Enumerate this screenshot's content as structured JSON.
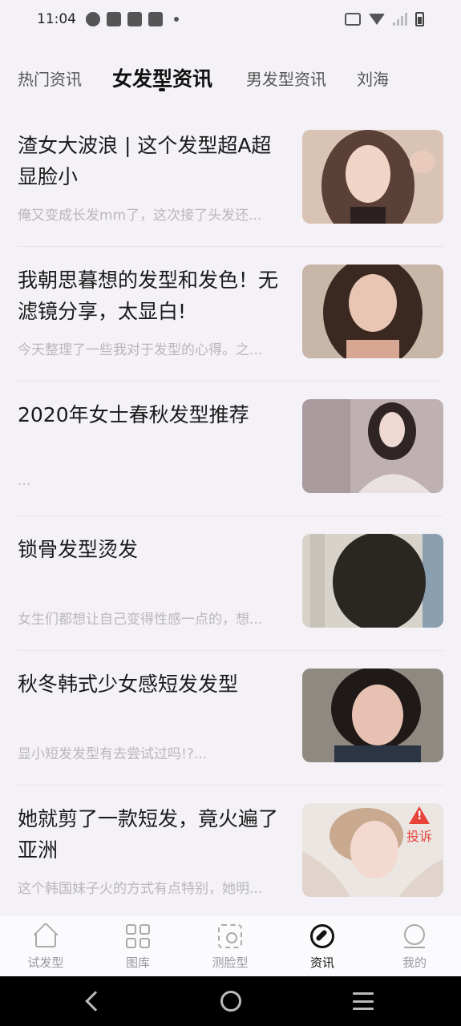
{
  "status_bar": {
    "time": "11:04",
    "icons": [
      "camera-icon",
      "mail-icon",
      "mail-icon",
      "mail-icon",
      "dot-icon"
    ],
    "right_icons": [
      "vibrate-icon",
      "wifi-icon",
      "signal-icon",
      "battery-icon"
    ]
  },
  "tabs": [
    {
      "label": "热门资讯",
      "active": false
    },
    {
      "label": "女发型资讯",
      "active": true
    },
    {
      "label": "男发型资讯",
      "active": false
    },
    {
      "label": "刘海",
      "active": false
    }
  ],
  "articles": [
    {
      "title": "渣女大波浪 | 这个发型超A超显脸小",
      "summary": "俺又变成长发mm了，这次接了头发还...",
      "thumb_colors": [
        "#d9c3b5",
        "#5a4036",
        "#f0d5c6"
      ]
    },
    {
      "title": "我朝思暮想的发型和发色！无滤镜分享，太显白!",
      "summary": "今天整理了一些我对于发型的心得。之...",
      "thumb_colors": [
        "#c8b6a8",
        "#3b2820",
        "#e9c5b4"
      ]
    },
    {
      "title": "2020年女士春秋发型推荐",
      "summary": "...",
      "thumb_colors": [
        "#bfb0b3",
        "#2f2524",
        "#eae2e2"
      ]
    },
    {
      "title": "锁骨发型烫发",
      "summary": "女生们都想让自己变得性感一点的，想...",
      "thumb_colors": [
        "#d7d3cb",
        "#2a2622",
        "#8aa0b1"
      ]
    },
    {
      "title": "秋冬韩式少女感短发发型",
      "summary": "显小短发发型有去尝试过吗!?...",
      "thumb_colors": [
        "#8e8a82",
        "#1f1a18",
        "#e7c2b3"
      ]
    },
    {
      "title": "她就剪了一款短发，竟火遍了亚洲",
      "summary": "这个韩国妹子火的方式有点特别，她明...",
      "thumb_colors": [
        "#ece6e3",
        "#c9a98f",
        "#f3d9cf"
      ],
      "report": "投诉"
    }
  ],
  "bottom_nav": [
    {
      "label": "试发型",
      "icon": "home-icon",
      "active": false
    },
    {
      "label": "图库",
      "icon": "grid-icon",
      "active": false
    },
    {
      "label": "测脸型",
      "icon": "face-scan-icon",
      "active": false
    },
    {
      "label": "资讯",
      "icon": "compass-icon",
      "active": true
    },
    {
      "label": "我的",
      "icon": "profile-icon",
      "active": false
    }
  ],
  "system_nav": [
    "back-icon",
    "home-circle-icon",
    "menu-icon"
  ]
}
